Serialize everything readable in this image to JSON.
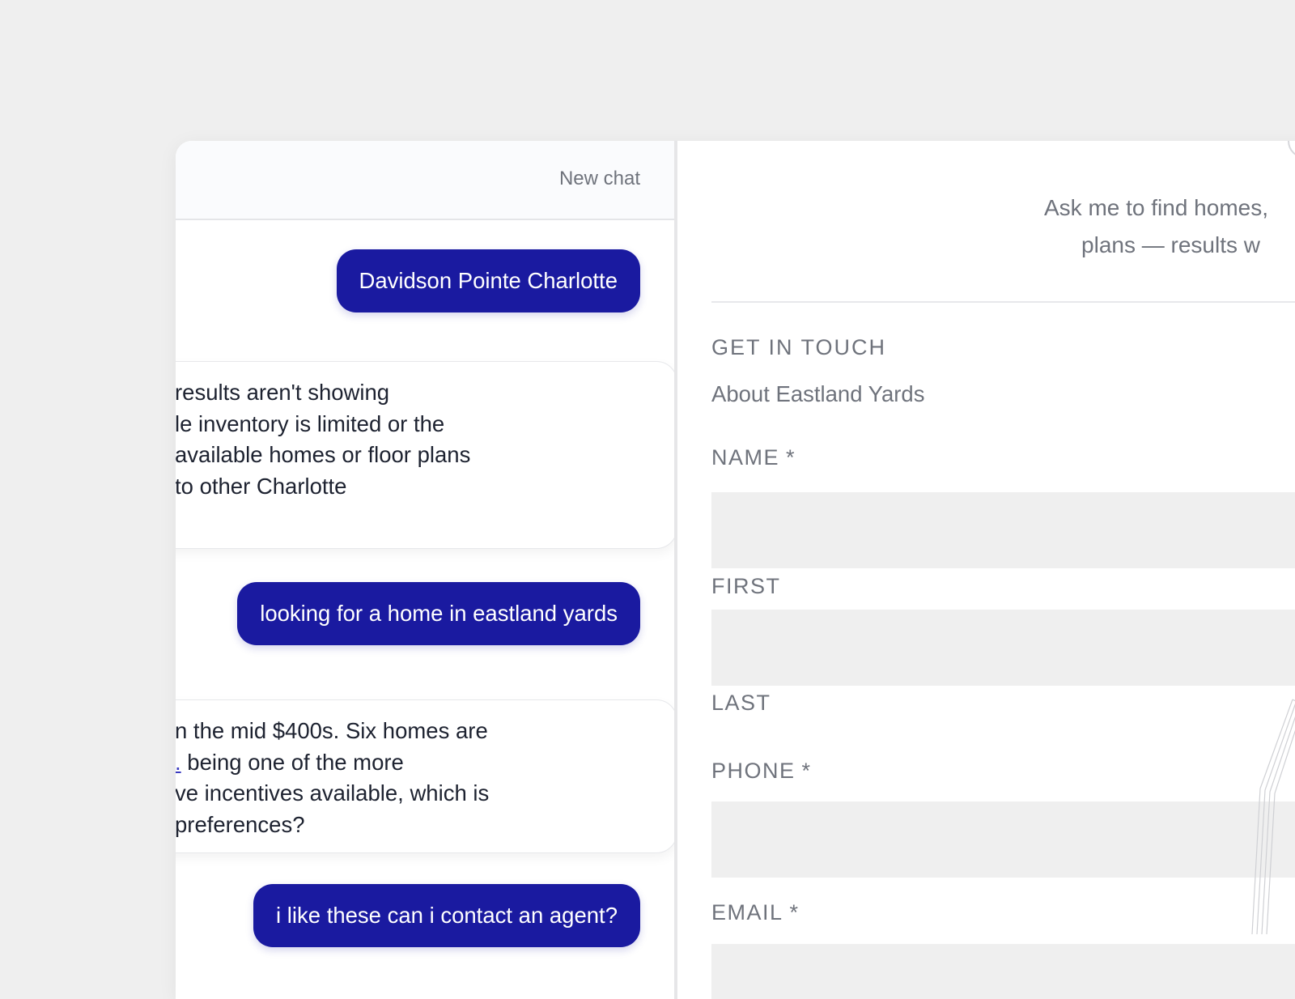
{
  "chat": {
    "new_chat_label": "New chat",
    "messages": [
      {
        "role": "user",
        "text": "Davidson Pointe Charlotte"
      },
      {
        "role": "assistant",
        "lines": [
          "results aren't showing",
          "le inventory is limited or the",
          " available homes or floor plans",
          " to other Charlotte"
        ]
      },
      {
        "role": "user",
        "text": "looking for a home in eastland yards"
      },
      {
        "role": "assistant",
        "lines": [
          "n the mid $400s. Six homes are",
          {
            "link": ".",
            "rest": " being one of the more"
          },
          "ve incentives available, which is",
          "preferences?"
        ]
      },
      {
        "role": "user",
        "text": "i like these can i contact an agent?"
      }
    ]
  },
  "form": {
    "intro_line1": "Ask me to find homes,",
    "intro_line2": "plans — results w",
    "section_title": "GET IN TOUCH",
    "section_subtitle": "About Eastland Yards",
    "name_label": "NAME",
    "first_label": "FIRST",
    "last_label": "LAST",
    "phone_label": "PHONE",
    "email_label": "EMAIL",
    "required_marker": "*",
    "first_value": "",
    "last_value": "",
    "phone_value": "",
    "email_value": ""
  },
  "colors": {
    "accent": "#1a1aa0",
    "background": "#efefef",
    "muted_text": "#6f737c",
    "input_fill": "#efefef"
  }
}
